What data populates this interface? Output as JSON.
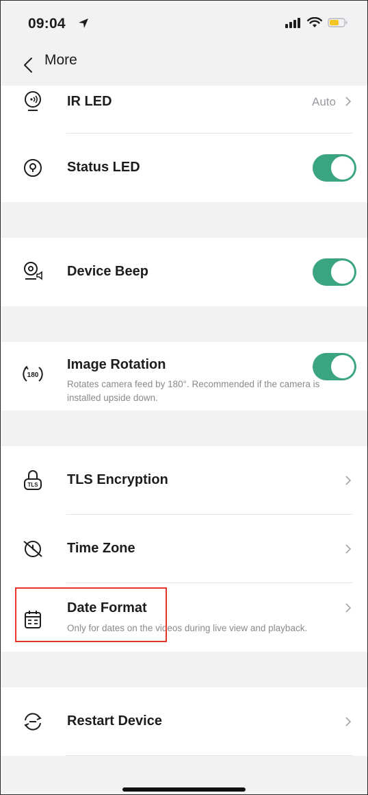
{
  "status_bar": {
    "time": "09:04",
    "location_icon": "location-arrow-icon",
    "signal_icon": "cellular-signal-icon",
    "wifi_icon": "wifi-icon",
    "battery_icon": "battery-icon",
    "battery_color": "#f3c623"
  },
  "nav": {
    "back_icon": "chevron-left-icon",
    "title": "More"
  },
  "items": {
    "ir_led": {
      "label": "IR LED",
      "value": "Auto",
      "icon": "ir-led-icon"
    },
    "status_led": {
      "label": "Status LED",
      "icon": "status-led-icon",
      "enabled": true
    },
    "device_beep": {
      "label": "Device Beep",
      "icon": "device-beep-icon",
      "enabled": true
    },
    "image_rotation": {
      "label": "Image Rotation",
      "description": "Rotates camera feed by 180°. Recommended if the camera is installed upside down.",
      "icon": "rotate-180-icon",
      "enabled": true
    },
    "tls_encryption": {
      "label": "TLS Encryption",
      "icon": "tls-lock-icon"
    },
    "time_zone": {
      "label": "Time Zone",
      "icon": "time-zone-icon"
    },
    "date_format": {
      "label": "Date Format",
      "description": "Only for dates on the videos during live view and playback.",
      "icon": "calendar-icon"
    },
    "restart_device": {
      "label": "Restart Device",
      "icon": "restart-icon"
    }
  },
  "colors": {
    "toggle_on": "#3aa57e",
    "highlight": "#e5322b",
    "background": "#f2f2f4"
  }
}
